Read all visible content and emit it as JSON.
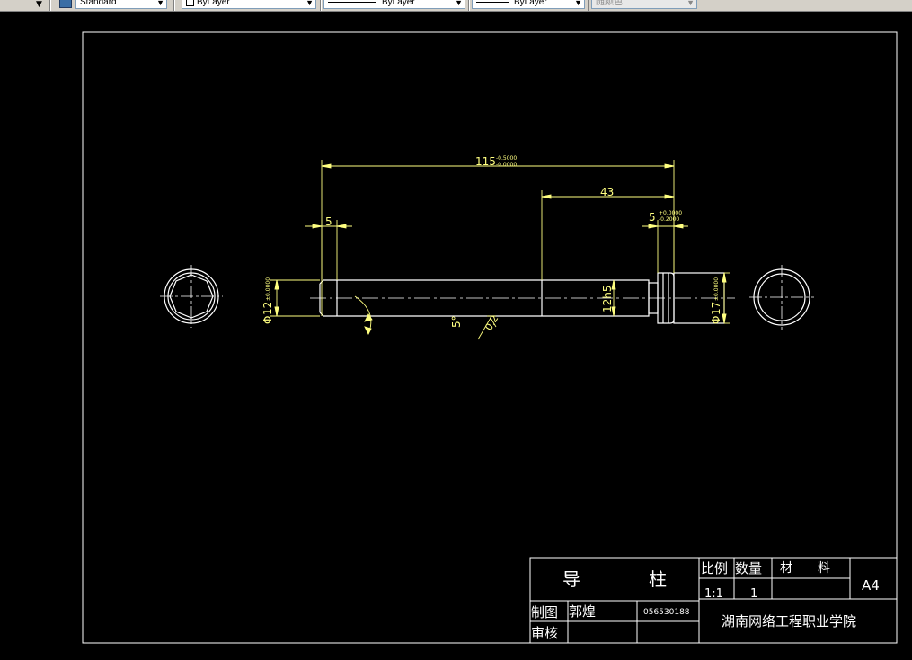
{
  "toolbar": {
    "text_style": "Standard",
    "layer": "ByLayer",
    "linetype": "ByLayer",
    "lineweight": "ByLayer",
    "color": "随颜色"
  },
  "dimensions": {
    "overall_length": "115",
    "overall_tol_upper": "-0.5000",
    "overall_tol_lower": "-0.0000",
    "length_43": "43",
    "length_5_left": "5",
    "length_5_right": "5",
    "length_5_tol_upper": "+0.0000",
    "length_5_tol_lower": "-0.2000",
    "dia_12_left": "12",
    "dia_12_left_prefix": "Φ",
    "dia_12_left_tol": "±0.0000",
    "dia_12_fit": "12h5",
    "dia_17": "17",
    "dia_17_prefix": "Φ",
    "dia_17_tol": "±0.0000",
    "angle_label": "5°",
    "roughness_label": "0.2"
  },
  "title_block": {
    "part_name_1": "导",
    "part_name_2": "柱",
    "scale_header": "比例",
    "qty_header": "数量",
    "material_header": "材　　料",
    "sheet_size": "A4",
    "scale_value": "1:1",
    "qty_value": "1",
    "drawn_label": "制图",
    "drawn_name": "郭煌",
    "drawn_id": "056530188",
    "review_label": "审核",
    "institution": "湖南网络工程职业学院"
  },
  "colors": {
    "background": "#000000",
    "geometry": "#ffffff",
    "dimension": "#ffff80",
    "centerline": "#ffffff"
  }
}
